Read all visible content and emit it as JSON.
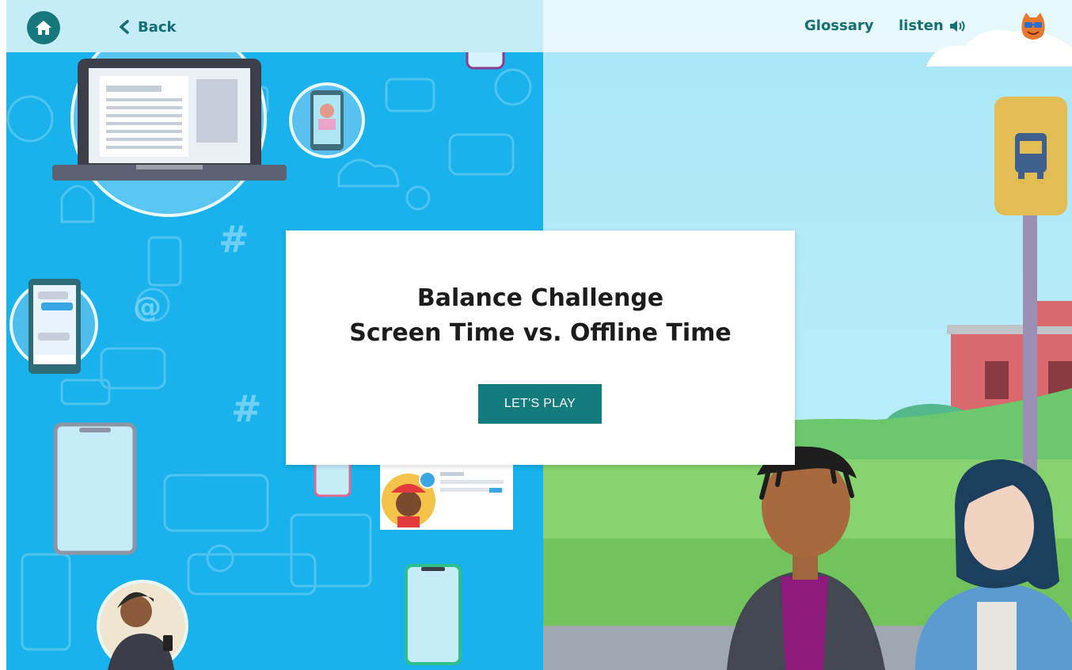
{
  "header": {
    "home_icon": "home-icon",
    "back_label": "Back",
    "back_icon": "chevron-left-icon",
    "glossary_label": "Glossary",
    "listen_label": "listen",
    "listen_icon": "speaker-icon",
    "avatar_icon": "cat-avatar-icon"
  },
  "modal": {
    "title_line1": "Balance Challenge",
    "title_line2": "Screen Time vs. Offline Time",
    "play_label": "LET'S PLAY"
  },
  "scene": {
    "left_theme": "screen-time",
    "right_theme": "offline-time",
    "bus_stop_icon": "bus-icon"
  },
  "colors": {
    "accent": "#137a7e",
    "left_panel": "#19b2ec",
    "sky": "#b8ecfa",
    "grass": "#7ed16b",
    "building": "#d9696f",
    "bus_sign": "#e2bd54"
  }
}
